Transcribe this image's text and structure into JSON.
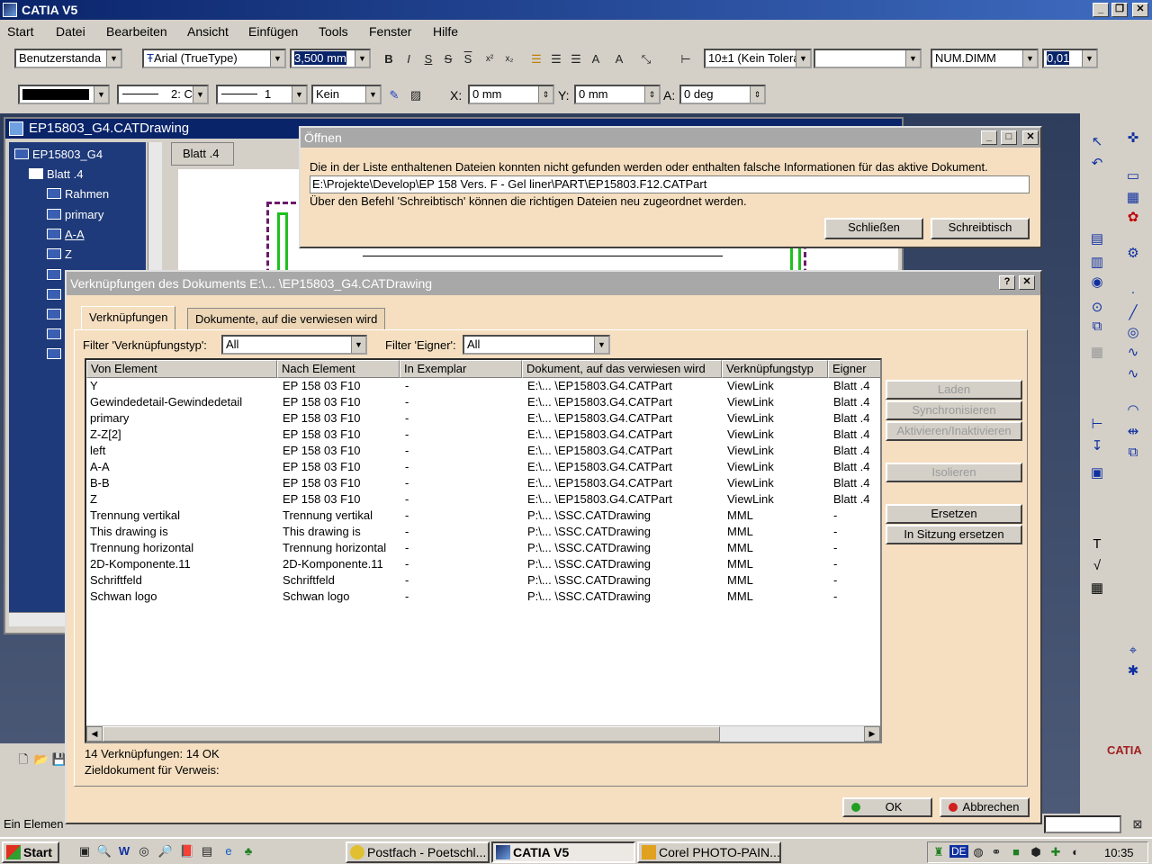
{
  "app": {
    "title": "CATIA V5"
  },
  "menu": [
    "Start",
    "Datei",
    "Bearbeiten",
    "Ansicht",
    "Einfügen",
    "Tools",
    "Fenster",
    "Hilfe"
  ],
  "toolbar1": {
    "style": "Benutzerstanda",
    "font": "Arial (TrueType)",
    "font_size": "3,500 mm",
    "tolerance": "10±1 (Kein Tolera",
    "blank_combo": "",
    "num_format": "NUM.DIMM",
    "precision": "0,01"
  },
  "toolbar2": {
    "line_type": "2: C",
    "thickness": "1",
    "pattern": "Kein",
    "x_label": "X:",
    "x_value": "0 mm",
    "y_label": "Y:",
    "y_value": "0 mm",
    "a_label": "A:",
    "a_value": "0 deg"
  },
  "drawing_window": {
    "title": "EP15803_G4.CATDrawing",
    "sheet_tab": "Blatt .4",
    "tree": [
      "EP15803_G4",
      "Blatt .4",
      "Rahmen",
      "primary",
      "A-A",
      "Z"
    ]
  },
  "open_dialog": {
    "title": "Öffnen",
    "message": "Die in der Liste enthaltenen Dateien konnten nicht gefunden werden oder enthalten falsche Informationen für das aktive Dokument.",
    "path": "E:\\Projekte\\Develop\\EP 158 Vers. F - Gel liner\\PART\\EP15803.F12.CATPart",
    "hint": "Über den Befehl 'Schreibtisch' können die richtigen Dateien neu zugeordnet werden.",
    "close_label": "Schließen",
    "desk_label": "Schreibtisch"
  },
  "links_dialog": {
    "title": "Verknüpfungen des Dokuments E:\\... \\EP15803_G4.CATDrawing",
    "tab1": "Verknüpfungen",
    "tab2": "Dokumente, auf die verwiesen wird",
    "filter_type_label": "Filter 'Verknüpfungstyp':",
    "filter_type_value": "All",
    "filter_owner_label": "Filter 'Eigner':",
    "filter_owner_value": "All",
    "columns": [
      "Von Element",
      "Nach Element",
      "In Exemplar",
      "Dokument, auf das verwiesen wird",
      "Verknüpfungstyp",
      "Eigner"
    ],
    "rows": [
      [
        "Y",
        "EP 158 03 F10",
        "-",
        "E:\\... \\EP15803.G4.CATPart",
        "ViewLink",
        "Blatt .4"
      ],
      [
        "Gewindedetail-Gewindedetail",
        "EP 158 03 F10",
        "-",
        "E:\\... \\EP15803.G4.CATPart",
        "ViewLink",
        "Blatt .4"
      ],
      [
        "primary",
        "EP 158 03 F10",
        "-",
        "E:\\... \\EP15803.G4.CATPart",
        "ViewLink",
        "Blatt .4"
      ],
      [
        "Z-Z[2]",
        "EP 158 03 F10",
        "-",
        "E:\\... \\EP15803.G4.CATPart",
        "ViewLink",
        "Blatt .4"
      ],
      [
        "left",
        "EP 158 03 F10",
        "-",
        "E:\\... \\EP15803.G4.CATPart",
        "ViewLink",
        "Blatt .4"
      ],
      [
        "A-A",
        "EP 158 03 F10",
        "-",
        "E:\\... \\EP15803.G4.CATPart",
        "ViewLink",
        "Blatt .4"
      ],
      [
        "B-B",
        "EP 158 03 F10",
        "-",
        "E:\\... \\EP15803.G4.CATPart",
        "ViewLink",
        "Blatt .4"
      ],
      [
        "Z",
        "EP 158 03 F10",
        "-",
        "E:\\... \\EP15803.G4.CATPart",
        "ViewLink",
        "Blatt .4"
      ],
      [
        "Trennung vertikal",
        "Trennung vertikal",
        "-",
        "P:\\... \\SSC.CATDrawing",
        "MML",
        "-"
      ],
      [
        "This drawing is",
        "This drawing is",
        "-",
        "P:\\... \\SSC.CATDrawing",
        "MML",
        "-"
      ],
      [
        "Trennung horizontal",
        "Trennung horizontal",
        "-",
        "P:\\... \\SSC.CATDrawing",
        "MML",
        "-"
      ],
      [
        "2D-Komponente.11",
        "2D-Komponente.11",
        "-",
        "P:\\... \\SSC.CATDrawing",
        "MML",
        "-"
      ],
      [
        "Schriftfeld",
        "Schriftfeld",
        "-",
        "P:\\... \\SSC.CATDrawing",
        "MML",
        "-"
      ],
      [
        "Schwan logo",
        "Schwan logo",
        "-",
        "P:\\... \\SSC.CATDrawing",
        "MML",
        "-"
      ]
    ],
    "buttons": {
      "load": "Laden",
      "sync": "Synchronisieren",
      "activate": "Aktivieren/Inaktivieren",
      "isolate": "Isolieren",
      "replace": "Ersetzen",
      "replace_session": "In Sitzung ersetzen"
    },
    "summary": "14 Verknüpfungen: 14 OK",
    "target": "Zieldokument für Verweis:",
    "ok_label": "OK",
    "cancel_label": "Abbrechen"
  },
  "statusbar": {
    "text": "Ein Elemen"
  },
  "taskbar": {
    "start": "Start",
    "tasks": [
      "Postfach - Poetschl...",
      "CATIA V5",
      "Corel PHOTO-PAIN..."
    ],
    "lang": "DE",
    "clock": "10:35"
  },
  "colors": {
    "title_bar": "#0a246a",
    "dialog_bg": "#f5dfc0",
    "tree_bg": "#1e3a7a"
  }
}
